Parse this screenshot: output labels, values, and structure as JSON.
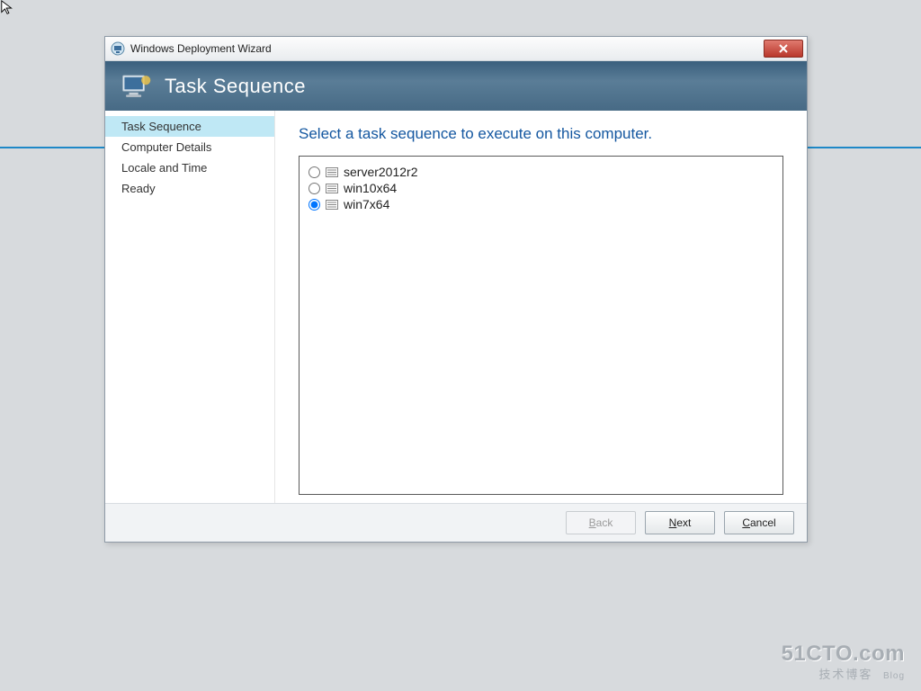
{
  "window": {
    "title": "Windows Deployment Wizard",
    "header_title": "Task Sequence"
  },
  "sidebar": {
    "items": [
      {
        "label": "Task Sequence",
        "active": true
      },
      {
        "label": "Computer Details",
        "active": false
      },
      {
        "label": "Locale and Time",
        "active": false
      },
      {
        "label": "Ready",
        "active": false
      }
    ]
  },
  "content": {
    "heading": "Select a task sequence to execute on this computer.",
    "options": [
      {
        "label": "server2012r2",
        "selected": false
      },
      {
        "label": "win10x64",
        "selected": false
      },
      {
        "label": "win7x64",
        "selected": true
      }
    ]
  },
  "footer": {
    "back": {
      "label": "Back",
      "accel": "B",
      "disabled": true
    },
    "next": {
      "label": "Next",
      "accel": "N",
      "disabled": false
    },
    "cancel": {
      "label": "Cancel",
      "accel": "C",
      "disabled": false
    }
  },
  "watermark": {
    "line1": "51CTO.com",
    "line2": "技术博客",
    "tag": "Blog"
  }
}
